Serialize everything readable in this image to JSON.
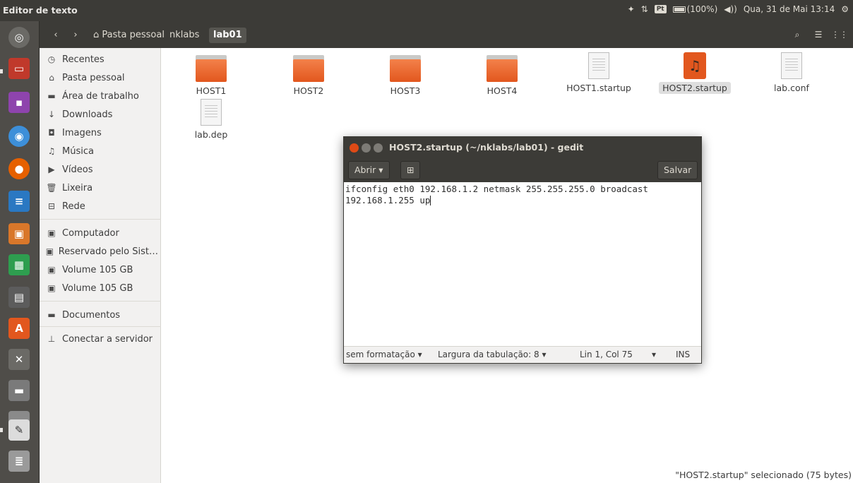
{
  "panel": {
    "app_title": "Editor de texto",
    "battery": "(100%)",
    "datetime": "Qua, 31 de Mai 13:14",
    "keyboard": "Pt"
  },
  "toolbar": {
    "crumbs": [
      "Pasta pessoal",
      "nklabs",
      "lab01"
    ]
  },
  "sidebar": {
    "items": [
      {
        "label": "Recentes",
        "icon": "clock-icon"
      },
      {
        "label": "Pasta pessoal",
        "icon": "home-icon"
      },
      {
        "label": "Área de trabalho",
        "icon": "desktop-folder-icon"
      },
      {
        "label": "Downloads",
        "icon": "download-icon"
      },
      {
        "label": "Imagens",
        "icon": "camera-icon"
      },
      {
        "label": "Música",
        "icon": "music-icon"
      },
      {
        "label": "Vídeos",
        "icon": "video-icon"
      },
      {
        "label": "Lixeira",
        "icon": "trash-icon"
      },
      {
        "label": "Rede",
        "icon": "network-icon"
      }
    ],
    "devices": [
      {
        "label": "Computador",
        "icon": "drive-icon"
      },
      {
        "label": "Reservado pelo Sist…",
        "icon": "drive-icon"
      },
      {
        "label": "Volume 105 GB",
        "icon": "drive-icon"
      },
      {
        "label": "Volume 105 GB",
        "icon": "drive-icon"
      }
    ],
    "bookmarks": [
      {
        "label": "Documentos",
        "icon": "folder-icon"
      }
    ],
    "connect": {
      "label": "Conectar a servidor",
      "icon": "server-icon"
    }
  },
  "files": [
    {
      "name": "HOST1",
      "type": "folder"
    },
    {
      "name": "HOST2",
      "type": "folder"
    },
    {
      "name": "HOST3",
      "type": "folder"
    },
    {
      "name": "HOST4",
      "type": "folder"
    },
    {
      "name": "HOST1.startup",
      "type": "text"
    },
    {
      "name": "HOST2.startup",
      "type": "audio",
      "selected": true
    },
    {
      "name": "lab.conf",
      "type": "text"
    },
    {
      "name": "lab.dep",
      "type": "text"
    }
  ],
  "status_text": "\"HOST2.startup\" selecionado  (75 bytes)",
  "gedit": {
    "title": "HOST2.startup (~/nklabs/lab01) - gedit",
    "open_label": "Abrir",
    "save_label": "Salvar",
    "content": "ifconfig eth0 192.168.1.2 netmask 255.255.255.0 broadcast 192.168.1.255 up",
    "status": {
      "format": "sem formatação",
      "tab_width": "Largura da tabulação: 8",
      "position": "Lin 1, Col 75",
      "mode": "INS"
    }
  },
  "colors": {
    "panel": "#3c3b37",
    "launcher": "#4f4d49",
    "folder_orange": "#e2571e",
    "sidebar_bg": "#f2f1f0",
    "close_button": "#df4a16"
  }
}
